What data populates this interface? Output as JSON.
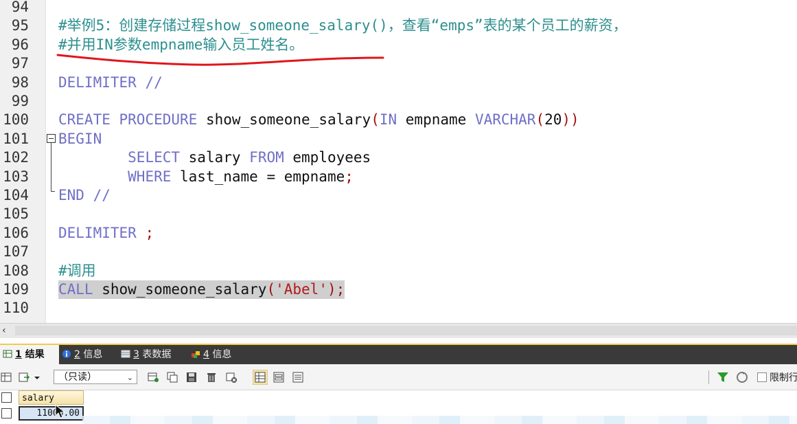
{
  "editor": {
    "lines": [
      {
        "num": "94",
        "tokens": []
      },
      {
        "num": "95",
        "tokens": [
          {
            "t": "#举例5：创建存储过程show_someone_salary()，查看“emps”表的某个员工的薪资，",
            "c": "cm"
          }
        ]
      },
      {
        "num": "96",
        "tokens": [
          {
            "t": "#并用IN参数empname输入员工姓名。",
            "c": "cm"
          }
        ]
      },
      {
        "num": "97",
        "tokens": []
      },
      {
        "num": "98",
        "tokens": [
          {
            "t": "DELIMITER",
            "c": "kw"
          },
          {
            "t": " //",
            "c": "kw"
          }
        ]
      },
      {
        "num": "99",
        "tokens": []
      },
      {
        "num": "100",
        "tokens": [
          {
            "t": "CREATE",
            "c": "kw"
          },
          {
            "t": " ",
            "c": ""
          },
          {
            "t": "PROCEDURE",
            "c": "kw"
          },
          {
            "t": " show_someone_salary",
            "c": ""
          },
          {
            "t": "(",
            "c": "pn"
          },
          {
            "t": "IN",
            "c": "kw"
          },
          {
            "t": " empname ",
            "c": ""
          },
          {
            "t": "VARCHAR",
            "c": "kw"
          },
          {
            "t": "(",
            "c": "pn"
          },
          {
            "t": "20",
            "c": ""
          },
          {
            "t": "))",
            "c": "pn"
          }
        ]
      },
      {
        "num": "101",
        "tokens": [
          {
            "t": "BEGIN",
            "c": "kw"
          }
        ]
      },
      {
        "num": "102",
        "tokens": [
          {
            "t": "        ",
            "c": ""
          },
          {
            "t": "SELECT",
            "c": "kw"
          },
          {
            "t": " salary ",
            "c": ""
          },
          {
            "t": "FROM",
            "c": "kw"
          },
          {
            "t": " employees",
            "c": ""
          }
        ]
      },
      {
        "num": "103",
        "tokens": [
          {
            "t": "        ",
            "c": ""
          },
          {
            "t": "WHERE",
            "c": "kw"
          },
          {
            "t": " last_name = empname",
            "c": ""
          },
          {
            "t": ";",
            "c": "pn"
          }
        ]
      },
      {
        "num": "104",
        "tokens": [
          {
            "t": "END",
            "c": "kw"
          },
          {
            "t": " //",
            "c": "kw"
          }
        ]
      },
      {
        "num": "105",
        "tokens": []
      },
      {
        "num": "106",
        "tokens": [
          {
            "t": "DELIMITER",
            "c": "kw"
          },
          {
            "t": " ",
            "c": ""
          },
          {
            "t": ";",
            "c": "pn"
          }
        ]
      },
      {
        "num": "107",
        "tokens": []
      },
      {
        "num": "108",
        "tokens": [
          {
            "t": "#调用",
            "c": "cm"
          }
        ]
      },
      {
        "num": "109",
        "selected": true,
        "tokens": [
          {
            "t": "CALL",
            "c": "kw"
          },
          {
            "t": " show_someone_salary",
            "c": ""
          },
          {
            "t": "(",
            "c": "pn"
          },
          {
            "t": "'Abel'",
            "c": "str"
          },
          {
            "t": ");",
            "c": "pn"
          }
        ]
      },
      {
        "num": "110",
        "tokens": []
      }
    ]
  },
  "scrollbar": {
    "left_arrow": "‹"
  },
  "result_tabs": [
    {
      "num": "1",
      "label": "结果",
      "active": true,
      "icon": "result-grid-icon"
    },
    {
      "num": "2",
      "label": "信息",
      "active": false,
      "icon": "info-icon"
    },
    {
      "num": "3",
      "label": "表数据",
      "active": false,
      "icon": "table-data-icon"
    },
    {
      "num": "4",
      "label": "信息",
      "active": false,
      "icon": "info-blocks-icon"
    }
  ],
  "toolbar": {
    "mode_value": "（只读）",
    "mode_arrow": "⌄",
    "limit_label": "限制行"
  },
  "grid": {
    "columns": [
      "salary"
    ],
    "rows": [
      [
        "11000.00"
      ]
    ]
  },
  "colors": {
    "keyword": "#6f6fc8",
    "comment": "#2d8f8f",
    "string": "#b31b1b",
    "annotation": "#e0161b",
    "tab_active_border": "#f2c94c"
  }
}
